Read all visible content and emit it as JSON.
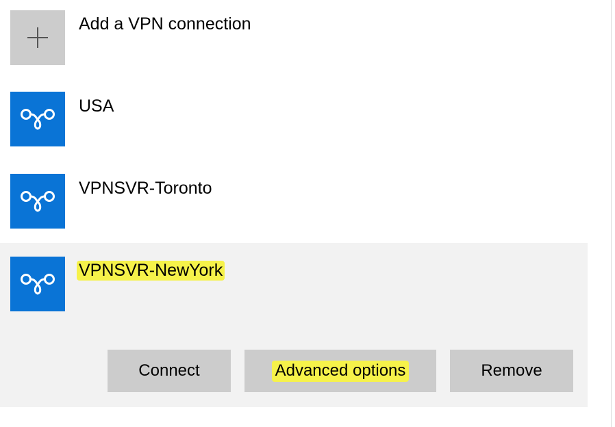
{
  "add_vpn": {
    "label": "Add a VPN connection",
    "icon": "plus-icon"
  },
  "connections": [
    {
      "name": "USA",
      "icon": "vpn-icon",
      "highlighted": false
    },
    {
      "name": "VPNSVR-Toronto",
      "icon": "vpn-icon",
      "highlighted": false
    },
    {
      "name": "VPNSVR-NewYork",
      "icon": "vpn-icon",
      "highlighted": true,
      "selected": true
    }
  ],
  "actions": {
    "connect_label": "Connect",
    "advanced_label": "Advanced options",
    "remove_label": "Remove"
  },
  "colors": {
    "tile_blue": "#0a74d6",
    "tile_gray": "#cccccc",
    "selected_row_bg": "#f2f2f2",
    "highlight_yellow": "#f6f24a",
    "button_bg": "#cccccc"
  }
}
